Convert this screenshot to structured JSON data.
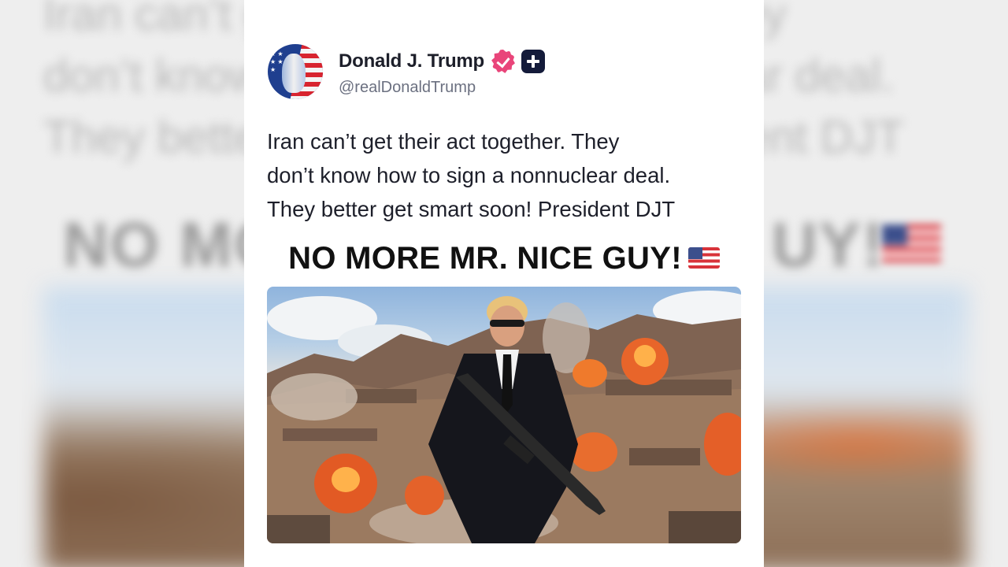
{
  "post": {
    "display_name": "Donald J. Trump",
    "handle": "@realDonaldTrump",
    "body": "Iran can’t get their act together. They\ndon’t know how to sign a nonnuclear deal.\nThey better get smart soon! President DJT",
    "image_headline": "NO MORE MR. NICE GUY!",
    "icons": {
      "avatar": "flag-portrait-avatar",
      "verified": "verified-badge-icon",
      "plus": "plus-badge-icon",
      "flag": "us-flag-emoji"
    },
    "colors": {
      "verified_badge": "#e9457a",
      "plus_badge": "#141b3a",
      "text": "#1d1f2a",
      "handle": "#6b7080"
    }
  },
  "background": {
    "blurred_text": "Iran can’t get their act together. They\ndon’t know how to sign a nonnuclear deal.\nThey better get smart soon! President DJT",
    "blurred_headline_left": "NO MO",
    "blurred_headline_right": "UY!"
  }
}
